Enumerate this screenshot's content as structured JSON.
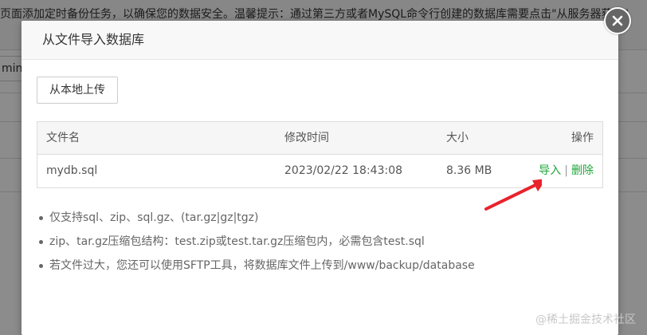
{
  "background": {
    "hint_text": "页面添加定时备份任务，以确保您的数据安全。温馨提示：通过第三方或者MySQL命令行创建的数据库需要点击\"从服务器获取\"",
    "input_fragment": "min"
  },
  "dialog": {
    "title": "从文件导入数据库",
    "close_icon": "close-icon",
    "upload_label": "从本地上传",
    "table": {
      "columns": [
        "文件名",
        "修改时间",
        "大小",
        "操作"
      ],
      "rows": [
        {
          "name": "mydb.sql",
          "modified": "2023/02/22 18:43:08",
          "size": "8.36 MB",
          "actions": {
            "import": "导入",
            "separator": "|",
            "delete": "删除"
          }
        }
      ]
    },
    "tips": [
      "仅支持sql、zip、sql.gz、(tar.gz|gz|tgz)",
      "zip、tar.gz压缩包结构：test.zip或test.tar.gz压缩包内，必需包含test.sql",
      "若文件过大，您还可以使用SFTP工具，将数据库文件上传到/www/backup/database"
    ]
  },
  "watermark": "@稀土掘金技术社区",
  "colors": {
    "accent_green": "#20a53a",
    "annotation_arrow": "#e8232c",
    "overlay": "rgba(0,0,0,0.45)"
  }
}
